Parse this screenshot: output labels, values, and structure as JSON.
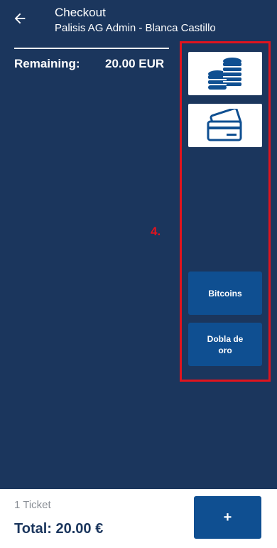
{
  "header": {
    "title": "Checkout",
    "subtitle": "Palisis AG Admin - Blanca Castillo",
    "back_icon": "arrow-left-icon"
  },
  "summary": {
    "remaining_label": "Remaining:",
    "remaining_value": "20.00 EUR"
  },
  "annotation": {
    "step_label": "4.",
    "color": "#e0141e"
  },
  "payment_methods": [
    {
      "icon": "coins-icon"
    },
    {
      "icon": "credit-card-icon"
    },
    {
      "label": "Bitcoins"
    },
    {
      "label": "Dobla de oro"
    }
  ],
  "footer": {
    "ticket_count": "1 Ticket",
    "total": "Total: 20.00 €",
    "add_label": "+"
  },
  "colors": {
    "background": "#1b365d",
    "accent": "#0f4f91"
  }
}
